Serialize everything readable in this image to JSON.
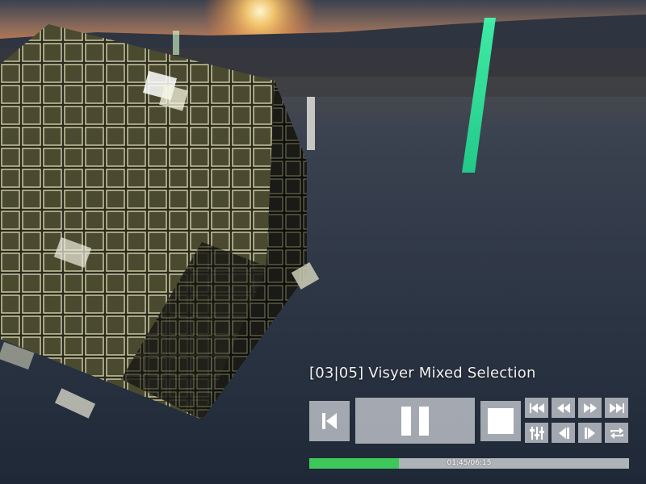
{
  "player": {
    "track_title": "[03|05]  Visyer Mixed Selection",
    "time_display": "01:45/06:15",
    "progress_fraction": 0.2794,
    "accent_color": "#3ec85c"
  },
  "controls": {
    "prev": {
      "icon": "skip-back-icon"
    },
    "pause": {
      "icon": "pause-icon"
    },
    "stop": {
      "icon": "stop-icon"
    },
    "small": [
      {
        "name": "first-button",
        "icon": "skip-first-icon"
      },
      {
        "name": "rewind-button",
        "icon": "rewind-icon"
      },
      {
        "name": "fast-forward-button",
        "icon": "fast-forward-icon"
      },
      {
        "name": "last-button",
        "icon": "skip-last-icon"
      },
      {
        "name": "equalizer-button",
        "icon": "sliders-icon"
      },
      {
        "name": "step-back-button",
        "icon": "step-back-icon"
      },
      {
        "name": "step-forward-button",
        "icon": "step-forward-icon"
      },
      {
        "name": "repeat-button",
        "icon": "repeat-icon"
      }
    ]
  }
}
